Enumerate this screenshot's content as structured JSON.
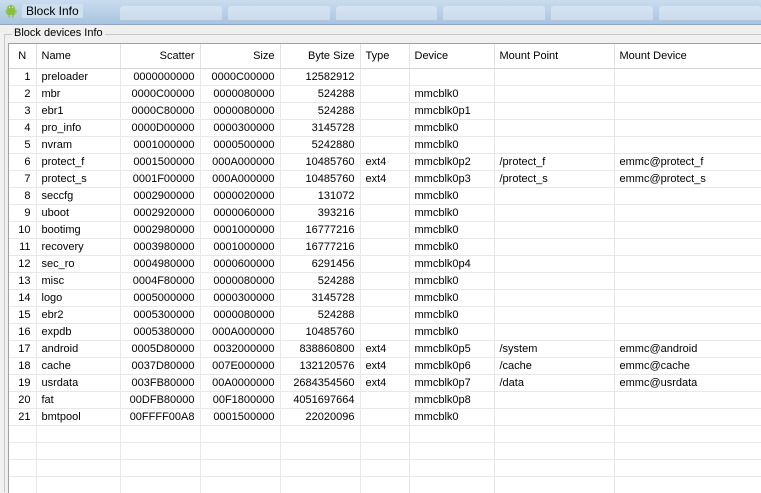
{
  "window": {
    "title": "Block Info"
  },
  "group": {
    "label": "Block devices Info"
  },
  "table": {
    "columns": [
      "N",
      "Name",
      "Scatter",
      "Size",
      "Byte Size",
      "Type",
      "Device",
      "Mount Point",
      "Mount Device"
    ],
    "rows": [
      [
        "1",
        "preloader",
        "0000000000",
        "0000C00000",
        "12582912",
        "",
        "",
        "",
        ""
      ],
      [
        "2",
        "mbr",
        "0000C00000",
        "0000080000",
        "524288",
        "",
        "mmcblk0",
        "",
        ""
      ],
      [
        "3",
        "ebr1",
        "0000C80000",
        "0000080000",
        "524288",
        "",
        "mmcblk0p1",
        "",
        ""
      ],
      [
        "4",
        "pro_info",
        "0000D00000",
        "0000300000",
        "3145728",
        "",
        "mmcblk0",
        "",
        ""
      ],
      [
        "5",
        "nvram",
        "0001000000",
        "0000500000",
        "5242880",
        "",
        "mmcblk0",
        "",
        ""
      ],
      [
        "6",
        "protect_f",
        "0001500000",
        "000A000000",
        "10485760",
        "ext4",
        "mmcblk0p2",
        "/protect_f",
        "emmc@protect_f"
      ],
      [
        "7",
        "protect_s",
        "0001F00000",
        "000A000000",
        "10485760",
        "ext4",
        "mmcblk0p3",
        "/protect_s",
        "emmc@protect_s"
      ],
      [
        "8",
        "seccfg",
        "0002900000",
        "0000020000",
        "131072",
        "",
        "mmcblk0",
        "",
        ""
      ],
      [
        "9",
        "uboot",
        "0002920000",
        "0000060000",
        "393216",
        "",
        "mmcblk0",
        "",
        ""
      ],
      [
        "10",
        "bootimg",
        "0002980000",
        "0001000000",
        "16777216",
        "",
        "mmcblk0",
        "",
        ""
      ],
      [
        "11",
        "recovery",
        "0003980000",
        "0001000000",
        "16777216",
        "",
        "mmcblk0",
        "",
        ""
      ],
      [
        "12",
        "sec_ro",
        "0004980000",
        "0000600000",
        "6291456",
        "",
        "mmcblk0p4",
        "",
        ""
      ],
      [
        "13",
        "misc",
        "0004F80000",
        "0000080000",
        "524288",
        "",
        "mmcblk0",
        "",
        ""
      ],
      [
        "14",
        "logo",
        "0005000000",
        "0000300000",
        "3145728",
        "",
        "mmcblk0",
        "",
        ""
      ],
      [
        "15",
        "ebr2",
        "0005300000",
        "0000080000",
        "524288",
        "",
        "mmcblk0",
        "",
        ""
      ],
      [
        "16",
        "expdb",
        "0005380000",
        "000A000000",
        "10485760",
        "",
        "mmcblk0",
        "",
        ""
      ],
      [
        "17",
        "android",
        "0005D80000",
        "0032000000",
        "838860800",
        "ext4",
        "mmcblk0p5",
        "/system",
        "emmc@android"
      ],
      [
        "18",
        "cache",
        "0037D80000",
        "007E000000",
        "132120576",
        "ext4",
        "mmcblk0p6",
        "/cache",
        "emmc@cache"
      ],
      [
        "19",
        "usrdata",
        "003FB80000",
        "00A0000000",
        "2684354560",
        "ext4",
        "mmcblk0p7",
        "/data",
        "emmc@usrdata"
      ],
      [
        "20",
        "fat",
        "00DFB80000",
        "00F1800000",
        "4051697664",
        "",
        "mmcblk0p8",
        "",
        ""
      ],
      [
        "21",
        "bmtpool",
        "00FFFF00A8",
        "0001500000",
        "22020096",
        "",
        "mmcblk0",
        "",
        ""
      ]
    ]
  },
  "icons": {
    "app": "android-icon"
  },
  "colors": {
    "title_bar": "#b9d1ea",
    "grid_line": "#e8e8e8"
  }
}
